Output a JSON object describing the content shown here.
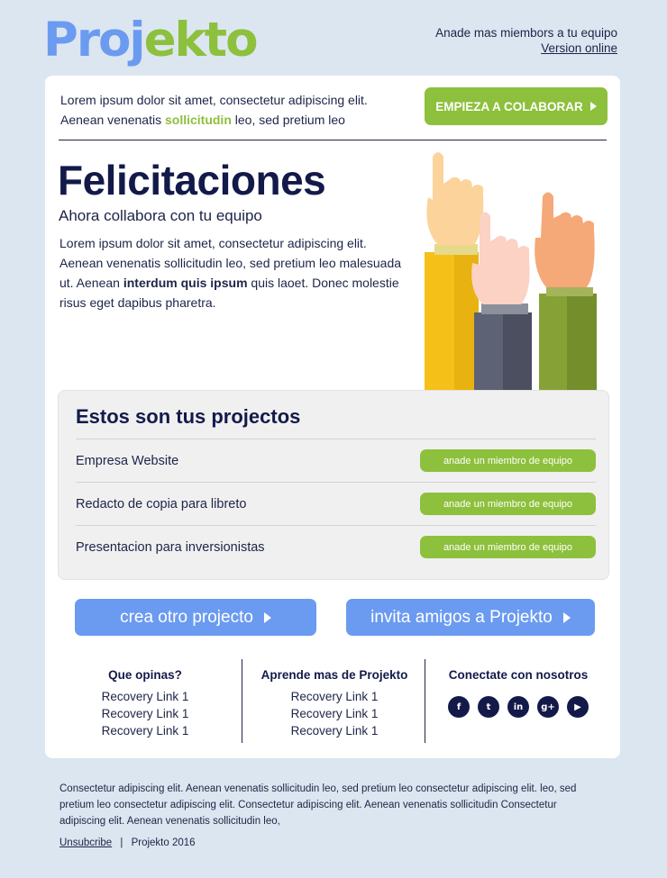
{
  "header": {
    "logo_part1": "Proj",
    "logo_part2": "ekto",
    "add_members_text": "Anade mas miembors a tu equipo",
    "online_version_link": "Version online"
  },
  "intro": {
    "line1": "Lorem ipsum dolor sit amet, consectetur adipiscing elit.",
    "line2_before": "Aenean venenatis ",
    "line2_highlight": "sollicitudin",
    "line2_after": " leo, sed pretium leo",
    "cta_label": "EMPIEZA A COLABORAR"
  },
  "hero": {
    "title": "Felicitaciones",
    "subtitle": "Ahora collabora con tu equipo",
    "body_before": "Lorem ipsum dolor sit amet, consectetur adipiscing elit. Aenean venenatis sollicitudin leo, sed pretium leo malesuada ut. Aenean ",
    "body_bold": "interdum quis ipsum",
    "body_after": " quis laoet. Donec molestie risus eget dapibus pharetra."
  },
  "projects": {
    "title": "Estos son tus projectos",
    "items": [
      {
        "name": "Empresa Website",
        "button": "anade un miembro de equipo"
      },
      {
        "name": "Redacto de copia para libreto",
        "button": "anade un miembro de equipo"
      },
      {
        "name": "Presentacion para inversionistas",
        "button": "anade un miembro de equipo"
      }
    ]
  },
  "actions": {
    "create_project": "crea otro projecto",
    "invite_friends": "invita amigos a Projekto"
  },
  "footer_links": {
    "col1_title": "Que opinas?",
    "col1_links": [
      "Recovery Link 1",
      "Recovery Link 1",
      "Recovery Link 1"
    ],
    "col2_title": "Aprende mas de Projekto",
    "col2_links": [
      "Recovery Link 1",
      "Recovery Link 1",
      "Recovery Link 1"
    ],
    "col3_title": "Conectate con nosotros",
    "social": [
      {
        "icon": "facebook-icon",
        "glyph": "f"
      },
      {
        "icon": "twitter-icon",
        "glyph": "t"
      },
      {
        "icon": "linkedin-icon",
        "glyph": "in"
      },
      {
        "icon": "google-plus-icon",
        "glyph": "g+"
      },
      {
        "icon": "youtube-icon",
        "glyph": "▶"
      }
    ]
  },
  "legal": {
    "text": "Consectetur adipiscing elit. Aenean venenatis sollicitudin leo, sed pretium leo consectetur adipiscing elit. leo, sed pretium leo consectetur adipiscing elit. Consectetur adipiscing elit. Aenean venenatis sollicitudin Consectetur adipiscing elit. Aenean venenatis sollicitudin leo,",
    "unsubscribe": "Unsubcribe",
    "separator": "|",
    "copyright": "Projekto 2016"
  },
  "colors": {
    "background": "#dce6f0",
    "green": "#8dc03c",
    "blue": "#6b9bf0",
    "navy": "#131a4a"
  }
}
